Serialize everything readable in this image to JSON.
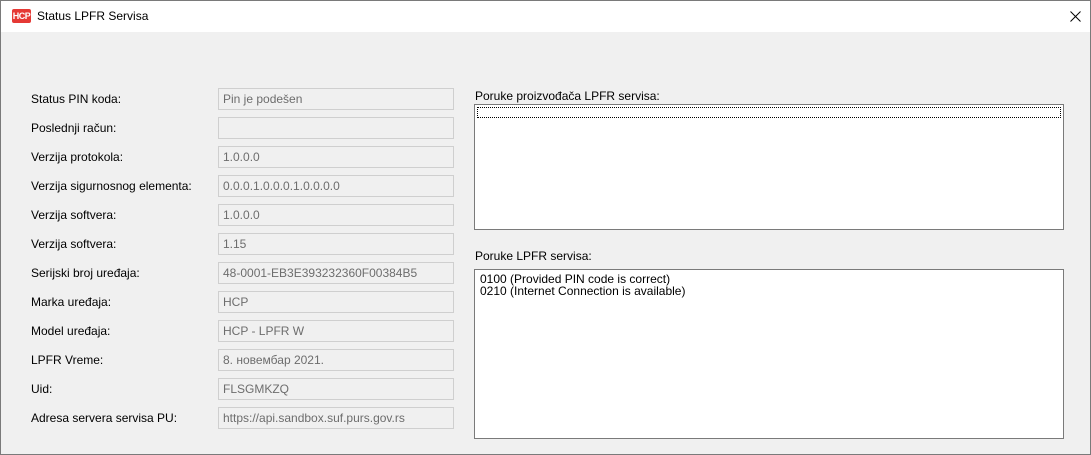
{
  "window": {
    "icon_text": "HCP",
    "title": "Status LPFR Servisa"
  },
  "fields": [
    {
      "label": "Status PIN koda:",
      "value": "Pin je podešen"
    },
    {
      "label": "Poslednji račun:",
      "value": ""
    },
    {
      "label": "Verzija protokola:",
      "value": "1.0.0.0"
    },
    {
      "label": "Verzija sigurnosnog elementa:",
      "value": "0.0.0.1.0.0.0.1.0.0.0.0"
    },
    {
      "label": "Verzija softvera:",
      "value": "1.0.0.0"
    },
    {
      "label": "Verzija softvera:",
      "value": "1.15"
    },
    {
      "label": "Serijski broj uređaja:",
      "value": "48-0001-EB3E393232360F00384B5"
    },
    {
      "label": "Marka uređaja:",
      "value": "HCP"
    },
    {
      "label": "Model uređaja:",
      "value": "HCP - LPFR W"
    },
    {
      "label": "LPFR Vreme:",
      "value": "8. новембар 2021."
    },
    {
      "label": "Uid:",
      "value": "FLSGMKZQ"
    },
    {
      "label": "Adresa servera servisa PU:",
      "value": "https://api.sandbox.suf.purs.gov.rs"
    }
  ],
  "manufacturer_messages": {
    "label": "Poruke proizvođača LPFR servisa:",
    "items": []
  },
  "service_messages": {
    "label": "Poruke LPFR servisa:",
    "items": [
      "0100 (Provided PIN code is correct)",
      "0210 (Internet Connection is available)"
    ]
  },
  "colors": {
    "app_icon": "#e53935",
    "window_bg": "#f0f0f0",
    "readonly_text": "#6d6d6d"
  }
}
